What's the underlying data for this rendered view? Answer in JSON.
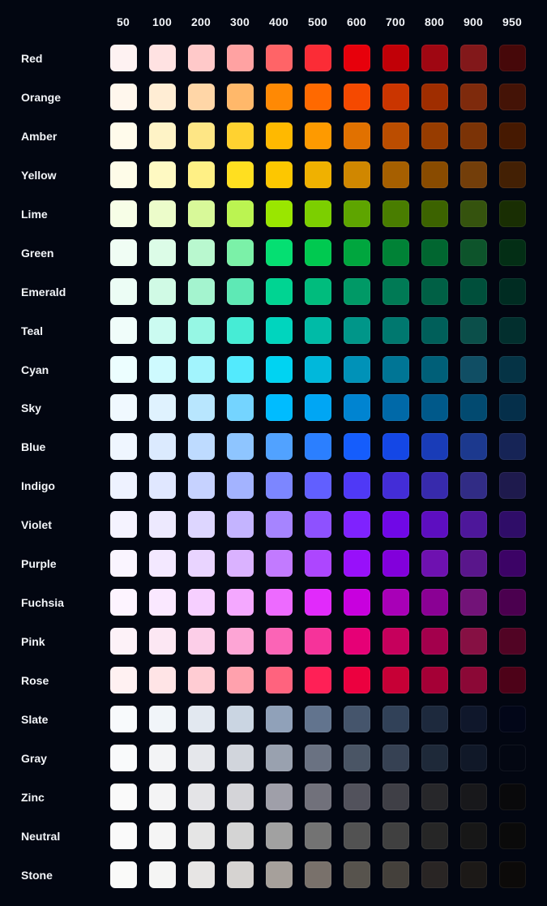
{
  "shades": [
    "50",
    "100",
    "200",
    "300",
    "400",
    "500",
    "600",
    "700",
    "800",
    "900",
    "950"
  ],
  "colors": [
    {
      "name": "Red",
      "swatches": [
        "#fef2f2",
        "#ffe2e2",
        "#ffc9c9",
        "#ffa2a2",
        "#ff6467",
        "#fb2c36",
        "#e7000b",
        "#c10007",
        "#9f0712",
        "#82181a",
        "#460809"
      ]
    },
    {
      "name": "Orange",
      "swatches": [
        "#fff7ed",
        "#ffedd4",
        "#ffd6a7",
        "#ffb86a",
        "#ff8904",
        "#ff6900",
        "#f54900",
        "#ca3500",
        "#9f2d00",
        "#7e2a0c",
        "#441306"
      ]
    },
    {
      "name": "Amber",
      "swatches": [
        "#fffbeb",
        "#fef3c6",
        "#fee685",
        "#ffd230",
        "#ffb900",
        "#fe9a00",
        "#e17100",
        "#bb4d00",
        "#973c00",
        "#7b3306",
        "#461901"
      ]
    },
    {
      "name": "Yellow",
      "swatches": [
        "#fefce8",
        "#fef9c2",
        "#fff085",
        "#ffdf20",
        "#fdc700",
        "#f0b100",
        "#d08700",
        "#a65f00",
        "#894b00",
        "#733e0a",
        "#432004"
      ]
    },
    {
      "name": "Lime",
      "swatches": [
        "#f7fee7",
        "#ecfcca",
        "#d8f999",
        "#bbf451",
        "#9ae600",
        "#7ccf00",
        "#5ea500",
        "#497d00",
        "#3c6300",
        "#35530e",
        "#192e03"
      ]
    },
    {
      "name": "Green",
      "swatches": [
        "#f0fdf4",
        "#dcfce7",
        "#b9f8cf",
        "#7bf1a8",
        "#05df72",
        "#00c950",
        "#00a63e",
        "#008236",
        "#016630",
        "#0d542b",
        "#032e15"
      ]
    },
    {
      "name": "Emerald",
      "swatches": [
        "#ecfdf5",
        "#d0fae5",
        "#a4f4cf",
        "#5ee9b5",
        "#00d492",
        "#00bc7d",
        "#009966",
        "#007a55",
        "#006045",
        "#004f3b",
        "#002c22"
      ]
    },
    {
      "name": "Teal",
      "swatches": [
        "#f0fdfa",
        "#cbfbf1",
        "#96f7e4",
        "#46ecd5",
        "#00d5be",
        "#00bba7",
        "#009689",
        "#00786f",
        "#005f5a",
        "#0b4f4a",
        "#022f2e"
      ]
    },
    {
      "name": "Cyan",
      "swatches": [
        "#ecfeff",
        "#cefafe",
        "#a2f4fd",
        "#53eafd",
        "#00d3f2",
        "#00b8db",
        "#0092b8",
        "#007595",
        "#005f78",
        "#104e64",
        "#053345"
      ]
    },
    {
      "name": "Sky",
      "swatches": [
        "#f0f9ff",
        "#dff2fe",
        "#b8e6fe",
        "#74d4ff",
        "#00bcff",
        "#00a6f4",
        "#0084d1",
        "#0069a8",
        "#00598a",
        "#024a70",
        "#052f4a"
      ]
    },
    {
      "name": "Blue",
      "swatches": [
        "#eff6ff",
        "#dbeafe",
        "#bedbff",
        "#8ec5ff",
        "#51a2ff",
        "#2b7fff",
        "#155dfc",
        "#1447e6",
        "#193cb8",
        "#1c398e",
        "#162456"
      ]
    },
    {
      "name": "Indigo",
      "swatches": [
        "#eef2ff",
        "#e0e7ff",
        "#c6d2ff",
        "#a3b3ff",
        "#7c86ff",
        "#615fff",
        "#4f39f6",
        "#432dd7",
        "#372aac",
        "#312c85",
        "#1e1a4d"
      ]
    },
    {
      "name": "Violet",
      "swatches": [
        "#f5f3ff",
        "#ede9fe",
        "#ddd6ff",
        "#c4b4ff",
        "#a684ff",
        "#8e51ff",
        "#7f22fe",
        "#7008e7",
        "#5d0ec0",
        "#4d179a",
        "#2f0d68"
      ]
    },
    {
      "name": "Purple",
      "swatches": [
        "#faf5ff",
        "#f3e8ff",
        "#e9d4ff",
        "#dab2ff",
        "#c27aff",
        "#ad46ff",
        "#9810fa",
        "#8200db",
        "#6e11b0",
        "#59168b",
        "#3c0366"
      ]
    },
    {
      "name": "Fuchsia",
      "swatches": [
        "#fdf4ff",
        "#fae8ff",
        "#f6cfff",
        "#f4a8ff",
        "#ed6aff",
        "#e12afb",
        "#c800de",
        "#a800b7",
        "#8a0194",
        "#721378",
        "#4b004f"
      ]
    },
    {
      "name": "Pink",
      "swatches": [
        "#fdf2f8",
        "#fce7f3",
        "#fccee8",
        "#fda5d5",
        "#fb64b6",
        "#f6339a",
        "#e60076",
        "#c6005c",
        "#a3004c",
        "#861043",
        "#510424"
      ]
    },
    {
      "name": "Rose",
      "swatches": [
        "#fff1f2",
        "#ffe4e6",
        "#ffccd3",
        "#ffa1ad",
        "#ff637e",
        "#ff2056",
        "#ec003f",
        "#c70036",
        "#a50036",
        "#8b0836",
        "#4d0218"
      ]
    },
    {
      "name": "Slate",
      "swatches": [
        "#f8fafc",
        "#f1f5f9",
        "#e2e8f0",
        "#cad5e2",
        "#90a1b9",
        "#62748e",
        "#45556c",
        "#314158",
        "#1d293d",
        "#0f172b",
        "#020618"
      ]
    },
    {
      "name": "Gray",
      "swatches": [
        "#f9fafb",
        "#f3f4f6",
        "#e5e7eb",
        "#d1d5dc",
        "#99a1af",
        "#6a7282",
        "#4a5565",
        "#364153",
        "#1e2939",
        "#101828",
        "#030712"
      ]
    },
    {
      "name": "Zinc",
      "swatches": [
        "#fafafa",
        "#f4f4f5",
        "#e4e4e7",
        "#d4d4d8",
        "#9f9fa9",
        "#71717b",
        "#52525c",
        "#3f3f46",
        "#27272a",
        "#18181b",
        "#09090b"
      ]
    },
    {
      "name": "Neutral",
      "swatches": [
        "#fafafa",
        "#f5f5f5",
        "#e5e5e5",
        "#d4d4d4",
        "#a1a1a1",
        "#737373",
        "#525252",
        "#404040",
        "#262626",
        "#171717",
        "#0a0a0a"
      ]
    },
    {
      "name": "Stone",
      "swatches": [
        "#fafaf9",
        "#f5f5f4",
        "#e7e5e4",
        "#d6d3d1",
        "#a6a09b",
        "#79716b",
        "#57534d",
        "#44403b",
        "#292524",
        "#1c1917",
        "#0c0a09"
      ]
    }
  ]
}
